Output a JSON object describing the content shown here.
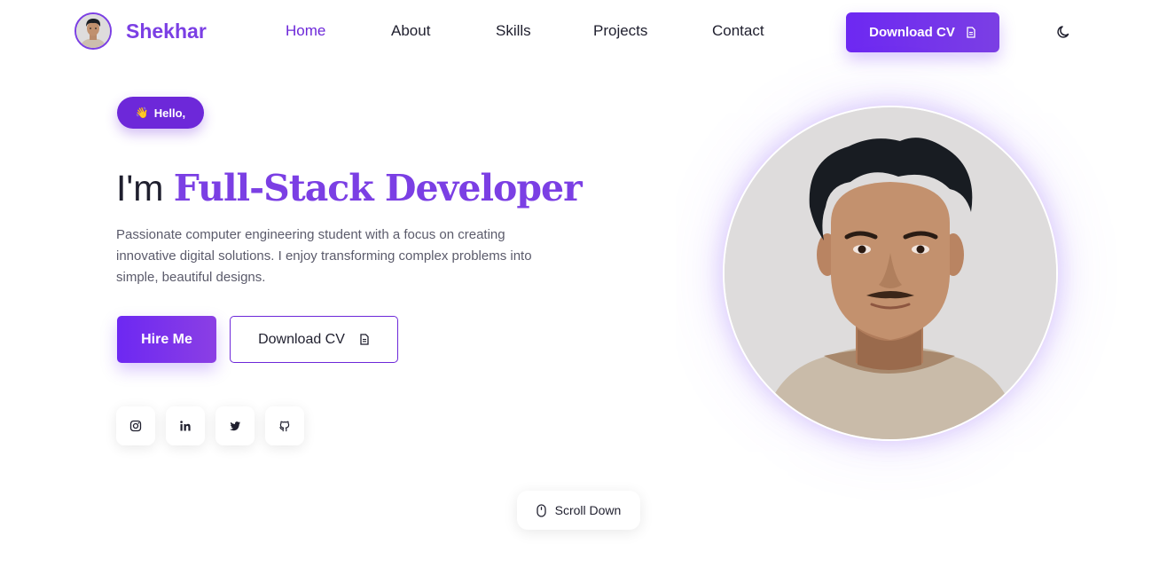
{
  "brand": {
    "name": "Shekhar",
    "avatar": "profile-avatar"
  },
  "nav": {
    "links": [
      {
        "label": "Home",
        "active": true
      },
      {
        "label": "About"
      },
      {
        "label": "Skills"
      },
      {
        "label": "Projects"
      },
      {
        "label": "Contact"
      }
    ],
    "cv_label": "Download CV",
    "cv_icon": "document-icon",
    "theme_icon": "moon-icon"
  },
  "hero": {
    "badge": {
      "emoji": "👋",
      "label": "Hello,"
    },
    "headline_prefix": "I'm",
    "headline_accent": "Full-Stack Developer",
    "intro_lines": [
      "Passionate computer engineering student with a focus on creating",
      "innovative digital solutions. I enjoy transforming complex problems into",
      "simple, beautiful designs."
    ],
    "hire_label": "Hire Me",
    "cv_label": "Download CV",
    "cv_icon": "document-icon"
  },
  "social": [
    "instagram-icon",
    "linkedin-icon",
    "twitter-icon",
    "github-icon"
  ],
  "scroll": {
    "label": "Scroll Down",
    "icon": "mouse-icon"
  },
  "colors": {
    "accent": "#7b3fe4",
    "accent_dark": "#6d28d9",
    "text": "#1f1f2e",
    "muted": "#5b5b6b",
    "portrait_bg": "#dedcdc"
  }
}
